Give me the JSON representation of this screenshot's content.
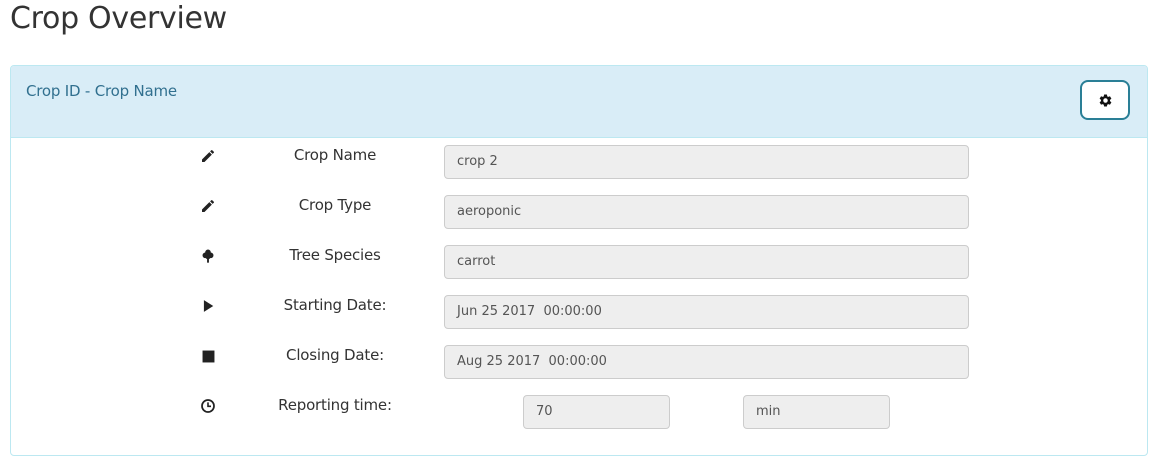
{
  "page": {
    "title": "Crop Overview"
  },
  "panel": {
    "title": "Crop ID - Crop Name",
    "settings_icon": "gear-icon"
  },
  "fields": {
    "crop_name": {
      "label": "Crop Name",
      "value": "crop 2",
      "icon": "pencil-icon"
    },
    "crop_type": {
      "label": "Crop Type",
      "value": "aeroponic",
      "icon": "pencil-icon"
    },
    "tree_species": {
      "label": "Tree Species",
      "value": "carrot",
      "icon": "tree-icon"
    },
    "starting_date": {
      "label": "Starting Date:",
      "value": "Jun 25 2017  00:00:00",
      "icon": "play-icon"
    },
    "closing_date": {
      "label": "Closing Date:",
      "value": "Aug 25 2017  00:00:00",
      "icon": "stop-icon"
    },
    "reporting_time": {
      "label": "Reporting time:",
      "value": "70",
      "unit": "min",
      "icon": "clock-icon"
    }
  },
  "colors": {
    "panel_heading_bg": "#d9edf7",
    "panel_border": "#bce8f1",
    "panel_title": "#31708f",
    "field_bg": "#eeeeee",
    "button_border": "#2a7f96"
  }
}
